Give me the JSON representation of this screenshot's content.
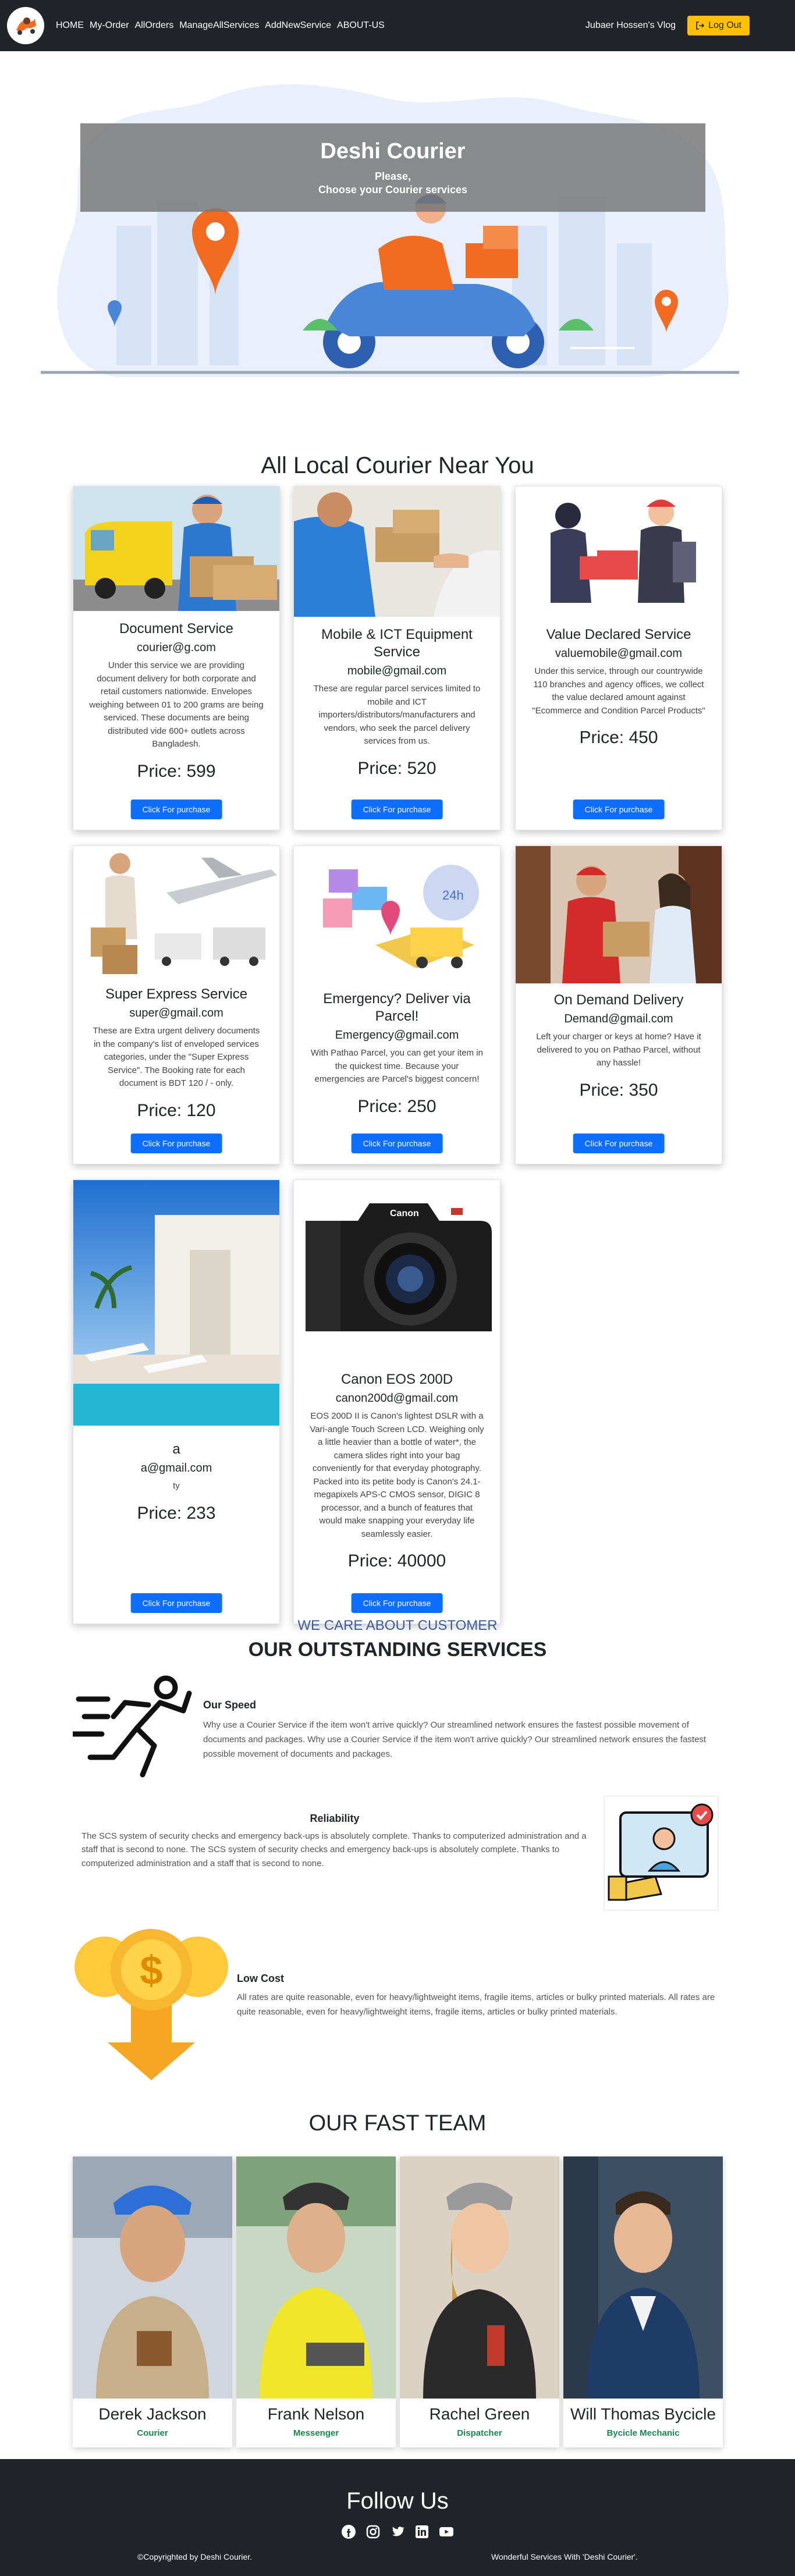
{
  "nav": {
    "links": [
      "HOME",
      "My-Order",
      "AllOrders",
      "ManageAllServices",
      "AddNewService",
      "ABOUT-US"
    ],
    "user": "Jubaer Hossen's Vlog",
    "logout": "Log Out"
  },
  "hero": {
    "title": "Deshi Courier",
    "line1": "Please,",
    "line2": "Choose your Courier services"
  },
  "services": {
    "heading": "All Local Courier Near You",
    "button_label": "Click For purchase",
    "items": [
      {
        "name": "Document Service",
        "email": "courier@g.com",
        "desc": "Under this service we are providing document delivery for both corporate and retail customers nationwide. Envelopes weighing between 01 to 200 grams are being serviced. These documents are being distributed vide 600+ outlets across Bangladesh.",
        "price": "Price: 599"
      },
      {
        "name": "Mobile & ICT Equipment Service",
        "email": "mobile@gmail.com",
        "desc": "These are regular parcel services limited to mobile and ICT importers/distributors/manufacturers and vendors, who seek the parcel delivery services from us.",
        "price": "Price: 520"
      },
      {
        "name": "Value Declared Service",
        "email": "valuemobile@gmail.com",
        "desc": "Under this service, through our countrywide 110 branches and agency offices, we collect the value declared amount against \"Ecommerce and Condition Parcel Products\"",
        "price": "Price: 450"
      },
      {
        "name": "Super Express Service",
        "email": "super@gmail.com",
        "desc": "These are Extra urgent delivery documents in the company's list of enveloped services categories, under the \"Super Express Service\". The Booking rate for each document is BDT 120 / - only.",
        "price": "Price: 120"
      },
      {
        "name": "Emergency? Deliver via Parcel!",
        "email": "Emergency@gmail.com",
        "desc": "With Pathao Parcel, you can get your item in the quickest time. Because your emergencies are Parcel's biggest concern!",
        "price": "Price: 250"
      },
      {
        "name": "On Demand Delivery",
        "email": "Demand@gmail.com",
        "desc": "Left your charger or keys at home? Have it delivered to you on Pathao Parcel, without any hassle!",
        "price": "Price: 350"
      },
      {
        "name": "a",
        "email": "a@gmail.com",
        "desc": "ty",
        "price": "Price: 233"
      },
      {
        "name": "Canon EOS 200D",
        "email": "canon200d@gmail.com",
        "desc": "EOS 200D II is Canon's lightest DSLR with a Vari-angle Touch Screen LCD. Weighing only a little heavier than a bottle of water*, the camera slides right into your bag conveniently for that everyday photography. Packed into its petite body is Canon's 24.1-megapixels APS-C CMOS sensor, DIGIC 8 processor, and a bunch of features that would make snapping your everyday life seamlessly easier.",
        "price": "Price: 40000"
      }
    ]
  },
  "why": {
    "kicker": "WE CARE ABOUT CUSTOMER",
    "title": "OUR OUTSTANDING SERVICES",
    "features": [
      {
        "title": "Our Speed",
        "text": "Why use a Courier Service if the item won't arrive quickly? Our streamlined network ensures the fastest possible movement of documents and packages. Why use a Courier Service if the item won't arrive quickly? Our streamlined network ensures the fastest possible movement of documents and packages."
      },
      {
        "title": "Reliability",
        "text": "The SCS system of security checks and emergency back-ups is absolutely complete. Thanks to computerized administration and a staff that is second to none. The SCS system of security checks and emergency back-ups is absolutely complete. Thanks to computerized administration and a staff that is second to none."
      },
      {
        "title": "Low Cost",
        "text": "All rates are quite reasonable, even for heavy/lightweight items, fragile items, articles or bulky printed materials. All rates are quite reasonable, even for heavy/lightweight items, fragile items, articles or bulky printed materials."
      }
    ]
  },
  "team": {
    "title": "OUR FAST TEAM",
    "members": [
      {
        "name": "Derek Jackson",
        "role": "Courier"
      },
      {
        "name": "Frank Nelson",
        "role": "Messenger"
      },
      {
        "name": "Rachel Green",
        "role": "Dispatcher"
      },
      {
        "name": "Will Thomas Bycicle",
        "role": "Bycicle Mechanic"
      }
    ]
  },
  "footer": {
    "follow": "Follow Us",
    "icons": [
      "facebook-icon",
      "instagram-icon",
      "twitter-icon",
      "linkedin-icon",
      "youtube-icon"
    ],
    "left": "©Copyrighted by Deshi Courier.",
    "right": "Wonderful Services With 'Deshi Courier'."
  },
  "colors": {
    "navbar": "#212529",
    "accent": "#ffc107",
    "primary_button": "#0d6efd",
    "team_role": "#198754",
    "hero_orange": "#f26b21"
  }
}
